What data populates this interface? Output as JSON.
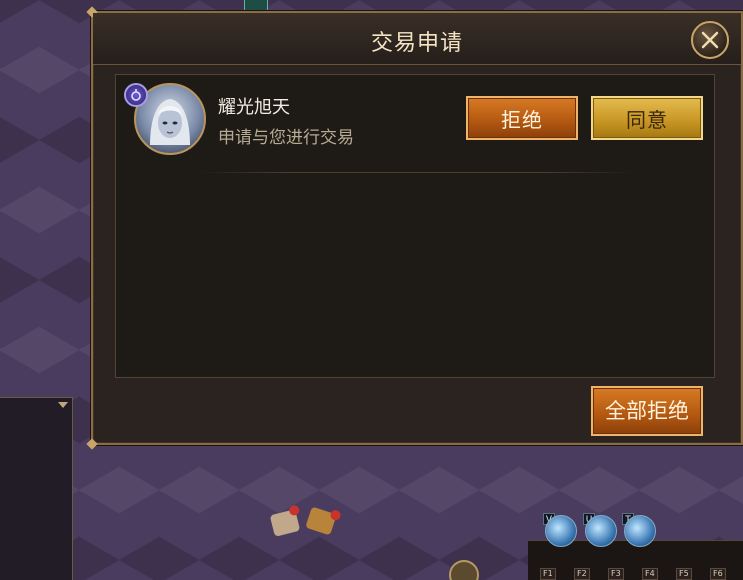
{
  "dialog": {
    "title": "交易申请",
    "close_icon": "close-icon",
    "refuse_all_label": "全部拒绝"
  },
  "requests": [
    {
      "player_name": "耀光旭天",
      "message": "申请与您进行交易",
      "avatar_icon": "player-portrait",
      "badge_icon": "class-badge-icon",
      "refuse_label": "拒绝",
      "agree_label": "同意"
    }
  ],
  "hud": {
    "skill_keys": [
      "V",
      "U",
      "T"
    ],
    "function_keys": [
      "F1",
      "F2",
      "F3",
      "F4",
      "F5",
      "F6"
    ]
  },
  "colors": {
    "title_text": "#f4e4c4",
    "refuse_button": "#c2681a",
    "agree_button": "#d4a834",
    "panel_border": "#8a6d44"
  }
}
